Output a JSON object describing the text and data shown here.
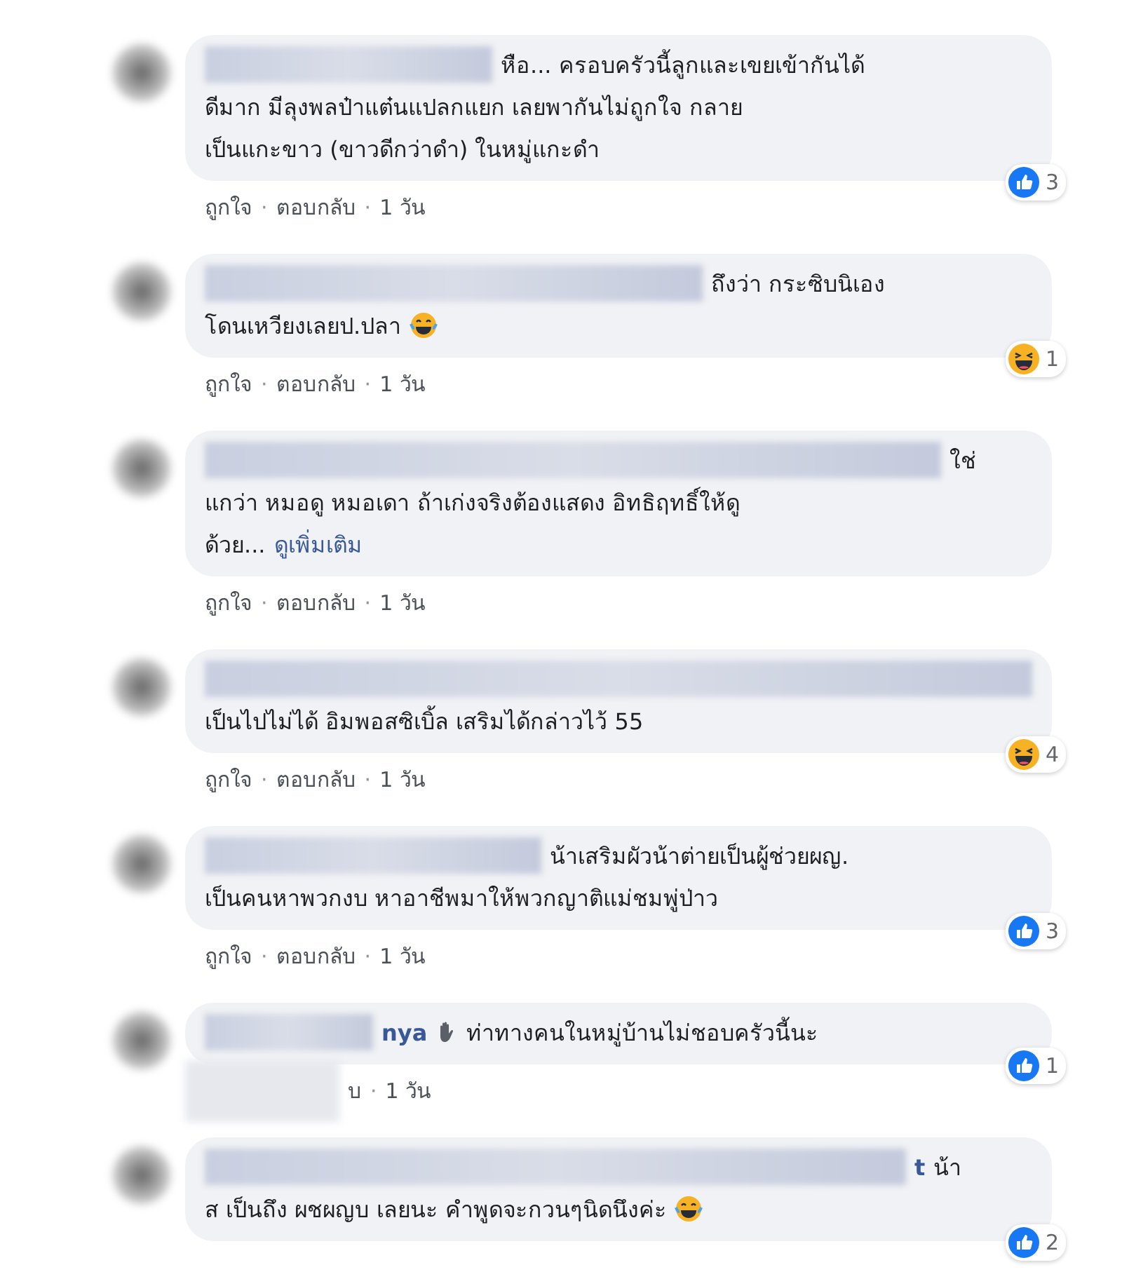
{
  "comments": [
    {
      "first_line": "หือ... ครอบครัวนี้ลูกและเขยเข้ากันได้",
      "lines": [
        "ดีมาก มีลุงพลป๋าแต๋นแปลกแยก เลยพากันไม่ถูกใจ กลาย",
        "เป็นแกะขาว (ขาวดีกว่าดำ) ในหมู่แกะดำ"
      ],
      "reaction": {
        "kind": "like",
        "count": "3"
      },
      "actions": [
        "ถูกใจ",
        "ตอบกลับ",
        "1 วัน"
      ]
    },
    {
      "first_line": "ถึงว่า กระซิบนิเอง",
      "lines": [
        "โดนเหวียงเลยป.ปลา"
      ],
      "ends_with_emoji": true,
      "reaction": {
        "kind": "haha",
        "count": "1"
      },
      "actions": [
        "ถูกใจ",
        "ตอบกลับ",
        "1 วัน"
      ]
    },
    {
      "first_line": "ใช่",
      "lines": [
        "แกว่า หมอดู หมอเดา ถ้าเก่งจริงต้องแสดง อิทธิฤทธิ์ให้ดู",
        "ด้วย..."
      ],
      "more_link": "ดูเพิ่มเติม",
      "actions": [
        "ถูกใจ",
        "ตอบกลับ",
        "1 วัน"
      ]
    },
    {
      "lines": [
        "เป็นไปไม่ได้ อิมพอสซิเบิ้ล เสริมได้กล่าวไว้ 55"
      ],
      "reaction": {
        "kind": "haha",
        "count": "4"
      },
      "actions": [
        "ถูกใจ",
        "ตอบกลับ",
        "1 วัน"
      ]
    },
    {
      "first_line": "น้าเสริมผัวน้าต่ายเป็นผู้ช่วยผญ.",
      "lines": [
        "เป็นคนหาพวกงบ หาอาชีพมาให้พวกญาติแม่ชมพู่ป่าว"
      ],
      "reaction": {
        "kind": "like",
        "count": "3"
      },
      "actions": [
        "ถูกใจ",
        "ตอบกลับ",
        "1 วัน"
      ]
    },
    {
      "author_fragment": "nya",
      "author_icon": true,
      "first_line": "ท่าทางคนในหมู่บ้านไม่ชอบครัวนี้นะ",
      "reaction": {
        "kind": "like",
        "count": "1"
      },
      "actions": [
        "บ",
        "1 วัน"
      ]
    },
    {
      "author_fragment": "t",
      "first_line": "น้า",
      "lines": [
        "ส เป็นถึง ผชผญบ เลยนะ คำพูดจะกวนๆนิดนึงค่ะ"
      ],
      "ends_with_emoji": true,
      "reaction": {
        "kind": "like",
        "count": "2"
      }
    }
  ],
  "separator": "·"
}
